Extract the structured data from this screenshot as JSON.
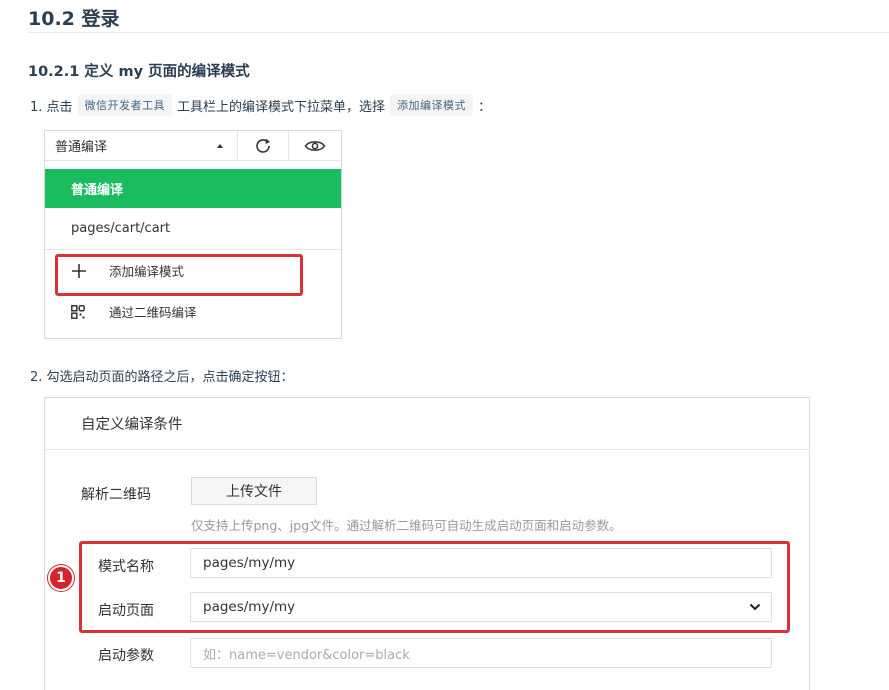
{
  "heading": {
    "section": "10.2 登录",
    "subsection": "10.2.1 定义 my 页面的编译模式"
  },
  "step1": {
    "prefix": "1. 点击",
    "code1": "微信开发者工具",
    "middle": "工具栏上的编译模式下拉菜单，选择",
    "code2": "添加编译模式",
    "suffix": "："
  },
  "dropdown": {
    "selected": "普通编译",
    "icons": [
      "refresh-icon",
      "eye-icon"
    ],
    "items": [
      {
        "label": "普通编译"
      },
      {
        "label": "pages/cart/cart"
      },
      {
        "label": "添加编译模式",
        "icon": "plus-icon"
      },
      {
        "label": "通过二维码编译",
        "icon": "qrcode-icon"
      }
    ],
    "highlight_color": "#1bbc60"
  },
  "step2": {
    "text": "2. 勾选启动页面的路径之后，点击确定按钮："
  },
  "modal": {
    "title": "自定义编译条件",
    "qr_label": "解析二维码",
    "upload_label": "上传文件",
    "upload_hint": "仅支持上传png、jpg文件。通过解析二维码可自动生成启动页面和启动参数。",
    "name_label": "模式名称",
    "name_value": "pages/my/my",
    "page_label": "启动页面",
    "page_value": "pages/my/my",
    "params_label": "启动参数",
    "params_placeholder": "如：name=vendor&color=black",
    "badge": "1"
  },
  "colors": {
    "annotation_red": "#d6323c"
  }
}
